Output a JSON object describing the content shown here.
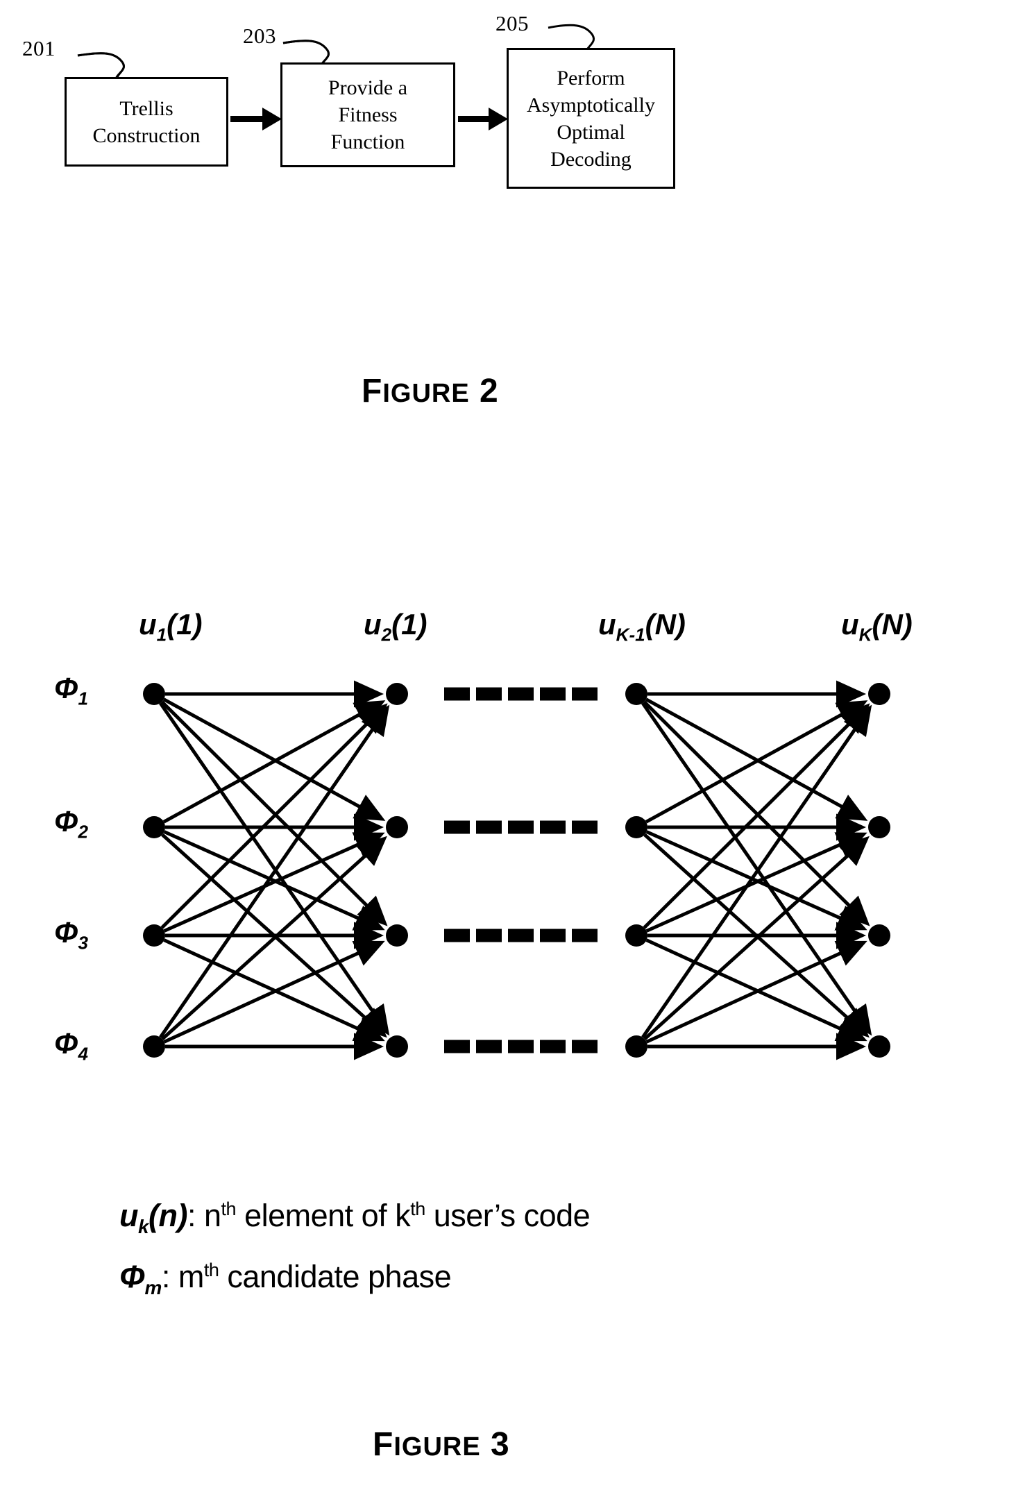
{
  "figure2": {
    "caption_word": "Figure",
    "caption_number": "2",
    "boxes": [
      {
        "ref": "201",
        "label": "Trellis\nConstruction"
      },
      {
        "ref": "203",
        "label": "Provide a\nFitness\nFunction"
      },
      {
        "ref": "205",
        "label": "Perform\nAsymptotically\nOptimal\nDecoding"
      }
    ],
    "arrows": 2
  },
  "figure3": {
    "caption_word": "Figure",
    "caption_number": "3",
    "column_headers": [
      {
        "base": "u",
        "sub": "1",
        "arg": "(1)"
      },
      {
        "base": "u",
        "sub": "2",
        "arg": "(1)"
      },
      {
        "base": "u",
        "sub": "K-1",
        "arg": "(N)"
      },
      {
        "base": "u",
        "sub": "K",
        "arg": "(N)"
      }
    ],
    "row_labels": [
      {
        "base": "Φ",
        "sub": "1"
      },
      {
        "base": "Φ",
        "sub": "2"
      },
      {
        "base": "Φ",
        "sub": "3"
      },
      {
        "base": "Φ",
        "sub": "4"
      }
    ],
    "dash_groups_per_row": 5,
    "legend": [
      {
        "symbol_base": "u",
        "symbol_sub": "k",
        "symbol_arg": "(n)",
        "text_before_sup1": ": n",
        "sup1": "th",
        "text_mid": " element of k",
        "sup2": "th",
        "text_after": " user’s code"
      },
      {
        "symbol_base": "Φ",
        "symbol_sub": "m",
        "symbol_arg": "",
        "text_before_sup1": ": m",
        "sup1": "th",
        "text_mid": " candidate phase",
        "sup2": "",
        "text_after": ""
      }
    ]
  },
  "colors": {
    "ink": "#000000",
    "paper": "#ffffff"
  }
}
